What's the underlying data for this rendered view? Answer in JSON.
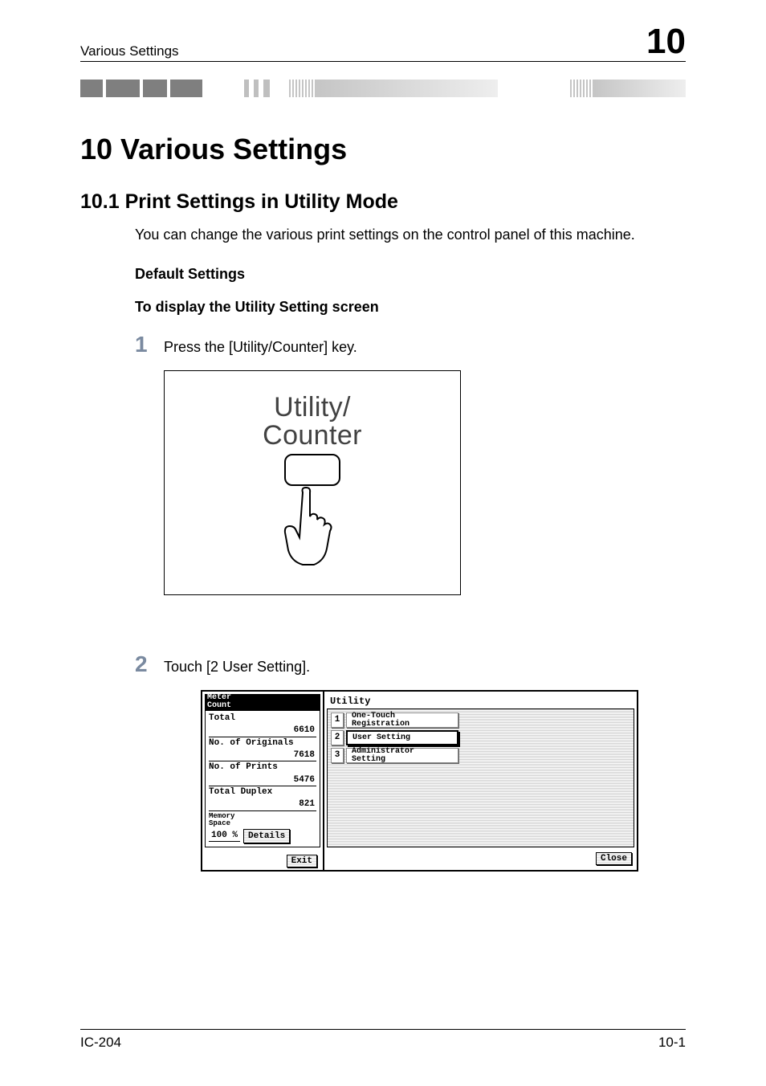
{
  "header": {
    "left": "Various Settings",
    "right": "10"
  },
  "chapter": {
    "number_title": "10   Various Settings"
  },
  "section": {
    "number_title": "10.1   Print Settings in Utility Mode",
    "intro": "You can change the various print settings on the control panel of this machine."
  },
  "subsection1": "Default Settings",
  "subsection2": "To display the Utility Setting screen",
  "step1": {
    "num": "1",
    "text": "Press the [Utility/Counter] key."
  },
  "illustration": {
    "line1": "Utility/",
    "line2": "Counter"
  },
  "step2": {
    "num": "2",
    "text": "Touch [2 User Setting]."
  },
  "touchscreen": {
    "meter_header": "Meter\nCount",
    "total_label": "Total",
    "total_value": "6610",
    "originals_label": "No. of Originals",
    "originals_value": "7618",
    "prints_label": "No. of Prints",
    "prints_value": "5476",
    "duplex_label": "Total Duplex",
    "duplex_value": "821",
    "memory_label": "Memory\nSpace",
    "memory_pct": "100 %",
    "details_btn": "Details",
    "exit_btn": "Exit",
    "utility_title": "Utility",
    "menu": [
      {
        "num": "1",
        "label": "One-Touch\nRegistration"
      },
      {
        "num": "2",
        "label": "User Setting"
      },
      {
        "num": "3",
        "label": "Administrator\nSetting"
      }
    ],
    "close_btn": "Close"
  },
  "footer": {
    "left": "IC-204",
    "right": "10-1"
  }
}
